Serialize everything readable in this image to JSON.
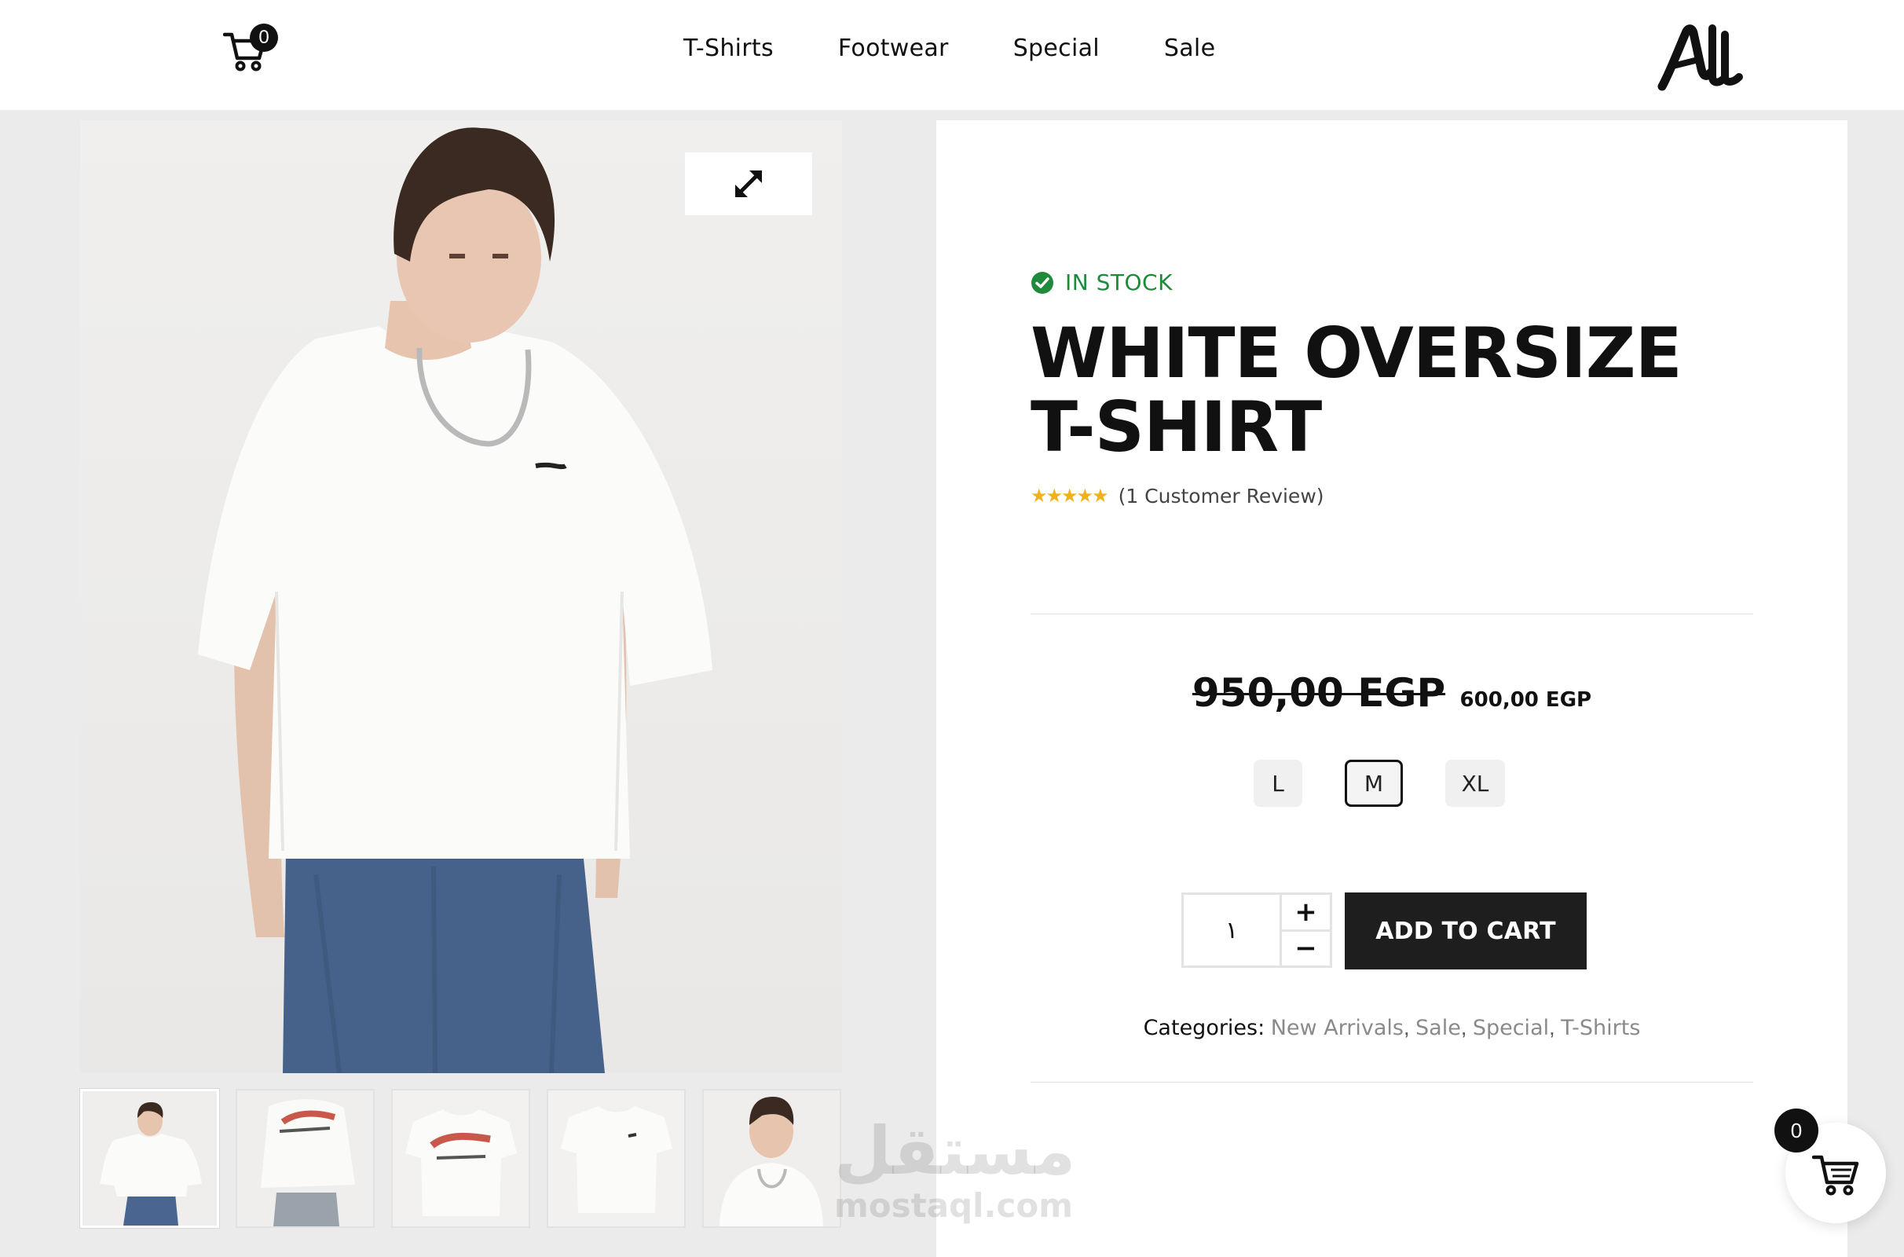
{
  "header": {
    "cart_count": "0",
    "nav": [
      {
        "label": "T-Shirts"
      },
      {
        "label": "Footwear"
      },
      {
        "label": "Special"
      },
      {
        "label": "Sale"
      }
    ]
  },
  "product": {
    "stock_status": "IN STOCK",
    "title": "WHITE OVERSIZE T-SHIRT",
    "rating_stars": "★★★★★",
    "rating": 5,
    "review_text": "(1 Customer Review)",
    "old_price": "950,00 EGP",
    "new_price": "600,00 EGP",
    "sizes": [
      {
        "label": "L",
        "selected": false
      },
      {
        "label": "M",
        "selected": true
      },
      {
        "label": "XL",
        "selected": false
      }
    ],
    "quantity": "١",
    "add_to_cart_label": "ADD TO CART",
    "categories_label": "Categories:",
    "categories": [
      "New Arrivals",
      "Sale",
      "Special",
      "T-Shirts"
    ]
  },
  "floating_cart": {
    "count": "0"
  },
  "watermark": {
    "arabic": "مستقل",
    "latin": "mostaql.com"
  },
  "icons": {
    "cart": "cart-icon",
    "zoom": "expand-arrows-icon",
    "stock": "check-circle-icon",
    "logo": "brand-logo"
  },
  "colors": {
    "accent_green": "#1f8a3a",
    "star_gold": "#f0b21a",
    "button_dark": "#1e1e1e",
    "category_link": "#8a8a8a"
  }
}
